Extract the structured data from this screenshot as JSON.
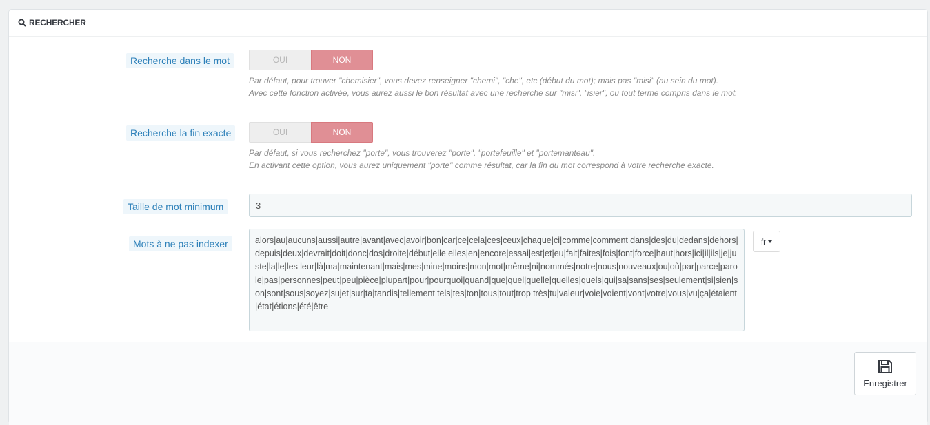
{
  "panel": {
    "title": "RECHERCHER"
  },
  "fields": {
    "partial": {
      "label": "Recherche dans le mot",
      "yes": "OUI",
      "no": "NON",
      "help1": "Par défaut, pour trouver \"chemisier\", vous devez renseigner \"chemi\", \"che\", etc (début du mot); mais pas \"misi\" (au sein du mot).",
      "help2": "Avec cette fonction activée, vous aurez aussi le bon résultat avec une recherche sur \"misi\", \"isier\", ou tout terme compris dans le mot."
    },
    "exact_end": {
      "label": "Recherche la fin exacte",
      "yes": "OUI",
      "no": "NON",
      "help1": "Par défaut, si vous recherchez \"porte\", vous trouverez \"porte\", \"portefeuille\" et \"portemanteau\".",
      "help2": "En activant cette option, vous aurez uniquement \"porte\" comme résultat, car la fin du mot correspond à votre recherche exacte."
    },
    "min_size": {
      "label": "Taille de mot minimum",
      "value": "3"
    },
    "blacklist": {
      "label": "Mots à ne pas indexer",
      "value": "alors|au|aucuns|aussi|autre|avant|avec|avoir|bon|car|ce|cela|ces|ceux|chaque|ci|comme|comment|dans|des|du|dedans|dehors|depuis|deux|devrait|doit|donc|dos|droite|début|elle|elles|en|encore|essai|est|et|eu|fait|faites|fois|font|force|haut|hors|ici|il|ils|je|juste|la|le|les|leur|là|ma|maintenant|mais|mes|mine|moins|mon|mot|même|ni|nommés|notre|nous|nouveaux|ou|où|par|parce|parole|pas|personnes|peut|peu|pièce|plupart|pour|pourquoi|quand|que|quel|quelle|quelles|quels|qui|sa|sans|ses|seulement|si|sien|son|sont|sous|soyez|sujet|sur|ta|tandis|tellement|tels|tes|ton|tous|tout|trop|très|tu|valeur|voie|voient|vont|votre|vous|vu|ça|étaient|état|étions|été|être",
      "lang": "fr"
    }
  },
  "footer": {
    "save_label": "Enregistrer"
  }
}
